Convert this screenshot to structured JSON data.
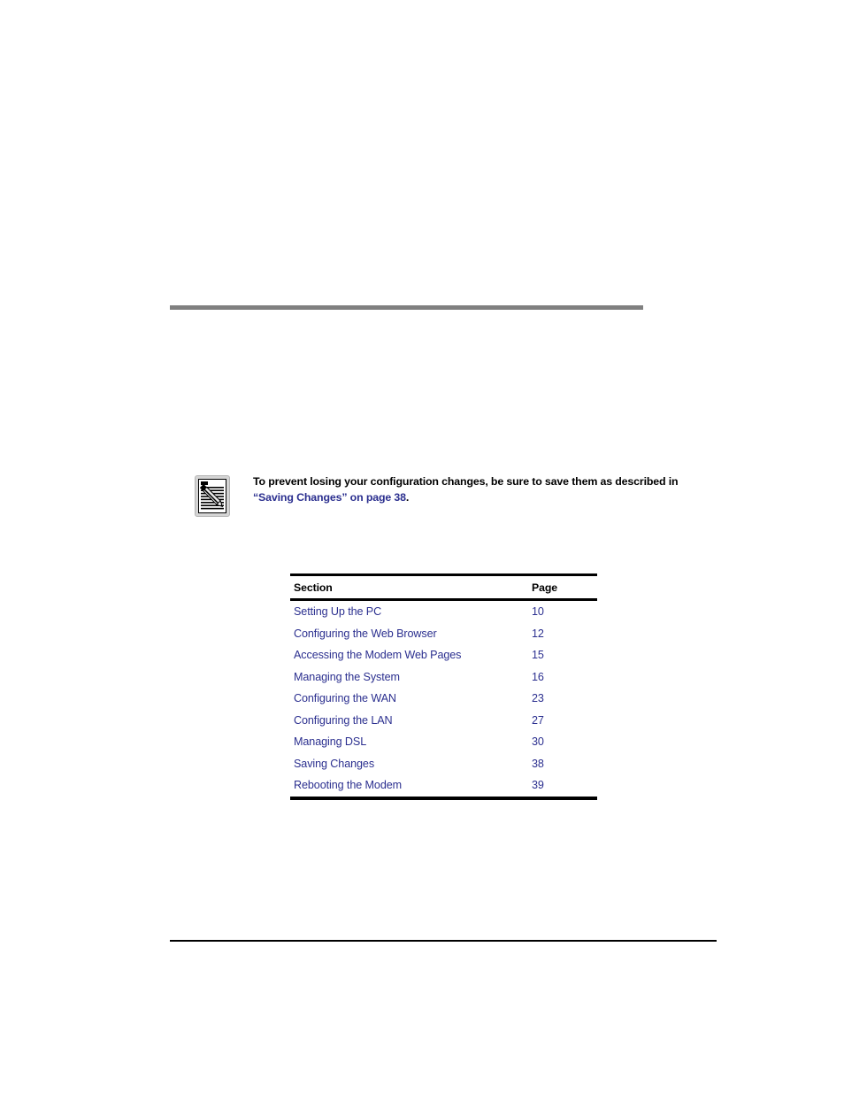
{
  "note": {
    "icon_name": "note-pencil-icon",
    "text_before_link": "To prevent losing your configuration changes, be sure to save them as described in ",
    "link_open_quote": "“",
    "link_text": "Saving Changes",
    "link_close_quote": "”",
    "link_suffix": " on page 38",
    "text_after_link": "."
  },
  "toc": {
    "headers": {
      "section": "Section",
      "page": "Page"
    },
    "rows": [
      {
        "section": "Setting Up the PC",
        "page": "10"
      },
      {
        "section": "Configuring the Web Browser",
        "page": "12"
      },
      {
        "section": "Accessing the Modem Web Pages",
        "page": "15"
      },
      {
        "section": "Managing the System",
        "page": "16"
      },
      {
        "section": "Configuring the WAN",
        "page": "23"
      },
      {
        "section": "Configuring the LAN",
        "page": "27"
      },
      {
        "section": "Managing DSL",
        "page": "30"
      },
      {
        "section": "Saving Changes",
        "page": "38"
      },
      {
        "section": "Rebooting the Modem",
        "page": "39"
      }
    ]
  },
  "colors": {
    "link": "#2b2f8f",
    "rule_gray": "#808080",
    "rule_black": "#000000",
    "text": "#000000"
  }
}
